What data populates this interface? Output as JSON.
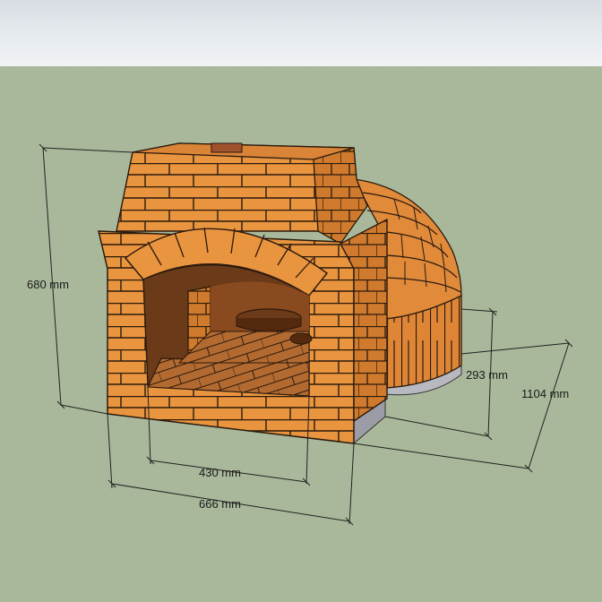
{
  "dimensions": {
    "height": "680 mm",
    "inner_width": "430 mm",
    "front_width": "666 mm",
    "dome_wall_height": "293 mm",
    "depth": "1104 mm"
  },
  "colors": {
    "sky": "#e6ebef",
    "ground": "#a9b89a",
    "brick": "#e9943e",
    "brick_dark": "#c86f25",
    "mortar": "#2a1a0e",
    "floor": "#b36a30",
    "concrete": "#b8b8c0"
  }
}
